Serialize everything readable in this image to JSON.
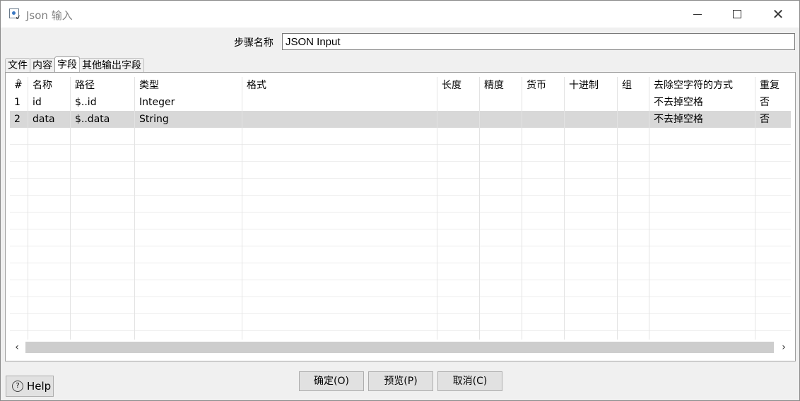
{
  "window": {
    "title": "Json 输入"
  },
  "step": {
    "label": "步骤名称",
    "value": "JSON Input"
  },
  "tabs": [
    {
      "label": "文件",
      "active": false
    },
    {
      "label": "内容",
      "active": false
    },
    {
      "label": "字段",
      "active": true
    },
    {
      "label": "其他输出字段",
      "active": false
    }
  ],
  "table": {
    "columns": [
      "#",
      "名称",
      "路径",
      "类型",
      "格式",
      "长度",
      "精度",
      "货币",
      "十进制",
      "组",
      "去除空字符的方式",
      "重复"
    ],
    "rows": [
      [
        "1",
        "id",
        "$..id",
        "Integer",
        "",
        "",
        "",
        "",
        "",
        "",
        "不去掉空格",
        "否"
      ],
      [
        "2",
        "data",
        "$..data",
        "String",
        "",
        "",
        "",
        "",
        "",
        "",
        "不去掉空格",
        "否"
      ]
    ],
    "selected_row": 2
  },
  "buttons": {
    "help": "Help",
    "ok": "确定(O)",
    "preview": "预览(P)",
    "cancel": "取消(C)"
  }
}
